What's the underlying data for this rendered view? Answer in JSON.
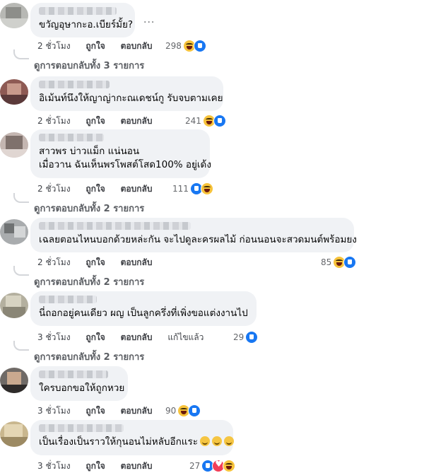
{
  "more_label": "...",
  "comments": [
    {
      "text_lines": [
        "ขวัญอุษากะอ.เบียร์มั้ย?"
      ],
      "meta": {
        "time": "2 ชั่วโมง",
        "like": "ถูกใจ",
        "reply": "ตอบกลับ"
      },
      "reaction_count": "298",
      "reactions": [
        "haha-icon",
        "like-icon"
      ],
      "replies_label": "ดูการตอบกลับทั้ง 3 รายการ"
    },
    {
      "text_lines": [
        "อิเม้นท์นึงให้ญาญ่ากะณเดชน์กู รับจบตามเคย"
      ],
      "meta": {
        "time": "2 ชั่วโมง",
        "like": "ถูกใจ",
        "reply": "ตอบกลับ"
      },
      "reaction_count": "241",
      "reactions": [
        "haha-icon",
        "like-icon"
      ]
    },
    {
      "text_lines": [
        "สาวพร บ่าวแม็ก แน่นอน",
        "เมื่อวาน ฉันเห็นพรโพสต์โสด100% อยู่เด้ง"
      ],
      "meta": {
        "time": "2 ชั่วโมง",
        "like": "ถูกใจ",
        "reply": "ตอบกลับ"
      },
      "reaction_count": "111",
      "reactions": [
        "like-icon",
        "haha-icon"
      ],
      "replies_label": "ดูการตอบกลับทั้ง 2 รายการ"
    },
    {
      "text_lines": [
        "เฉลยตอนไหนบอกด้วยหล่ะกัน จะไปดูละครผลไม้ ก่อนนอนจะสวดมนต์พร้อมยง"
      ],
      "meta": {
        "time": "2 ชั่วโมง",
        "like": "ถูกใจ",
        "reply": "ตอบกลับ"
      },
      "reaction_count": "85",
      "reactions": [
        "haha-icon",
        "like-icon"
      ],
      "replies_label": "ดูการตอบกลับทั้ง 2 รายการ"
    },
    {
      "text_lines": [
        "นี่ถอกอยู่คนเดียว ผญ เป็นลูกครึ่งที่เพิ่งขอแต่งงานไป"
      ],
      "meta": {
        "time": "3 ชั่วโมง",
        "like": "ถูกใจ",
        "reply": "ตอบกลับ",
        "edited": "แก้ไขแล้ว"
      },
      "reaction_count": "29",
      "reactions": [
        "like-icon"
      ],
      "replies_label": "ดูการตอบกลับทั้ง 2 รายการ"
    },
    {
      "text_lines": [
        "ใครบอกขอให้ถูกหวย"
      ],
      "meta": {
        "time": "3 ชั่วโมง",
        "like": "ถูกใจ",
        "reply": "ตอบกลับ"
      },
      "reaction_count": "90",
      "reactions": [
        "haha-icon",
        "like-icon"
      ]
    },
    {
      "text_lines": [
        "เป็นเรื่องเป็นราวให้กุนอนไม่หลับอีกแระ"
      ],
      "meta": {
        "time": "3 ชั่วโมง",
        "like": "ถูกใจ",
        "reply": "ตอบกลับ"
      },
      "reaction_count": "27",
      "reactions": [
        "like-icon",
        "love-icon",
        "haha-icon"
      ]
    }
  ]
}
